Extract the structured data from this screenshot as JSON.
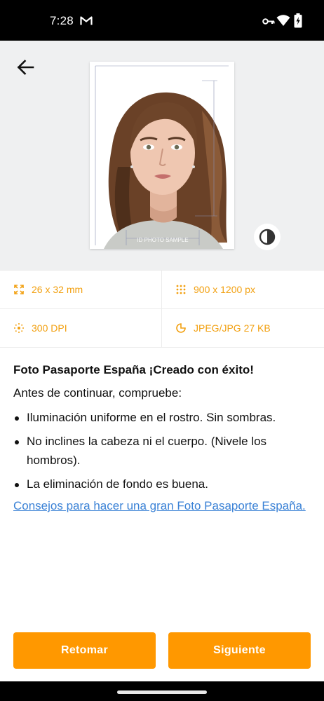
{
  "status_bar": {
    "time": "7:28",
    "icons": [
      "gmail-icon",
      "vpn-key-icon",
      "wifi-icon",
      "battery-charging-icon"
    ]
  },
  "preview": {
    "sample_watermark": "ID PHOTO SAMPLE",
    "icons": [
      "back-arrow-icon",
      "contrast-icon"
    ]
  },
  "specs": {
    "size": "26 x 32 mm",
    "resolution": "900 x 1200 px",
    "dpi": "300 DPI",
    "file": "JPEG/JPG 27 KB",
    "icons": [
      "resize-icon",
      "pixel-grid-icon",
      "dpi-dots-icon",
      "file-size-icon"
    ]
  },
  "info": {
    "title": "Foto Pasaporte España ¡Creado con éxito!",
    "intro": "Antes de continuar, compruebe:",
    "checklist": [
      "Iluminación uniforme en el rostro. Sin sombras.",
      "No inclines la cabeza ni el cuerpo. (Nivele los hombros).",
      "La eliminación de fondo es buena."
    ],
    "link": "Consejos para hacer una gran Foto Pasaporte España."
  },
  "buttons": {
    "retake": "Retomar",
    "next": "Siguiente"
  },
  "colors": {
    "accent": "#ff9800",
    "spec_text": "#f2a010",
    "link": "#3b82d6",
    "preview_bg": "#eff0f1"
  }
}
